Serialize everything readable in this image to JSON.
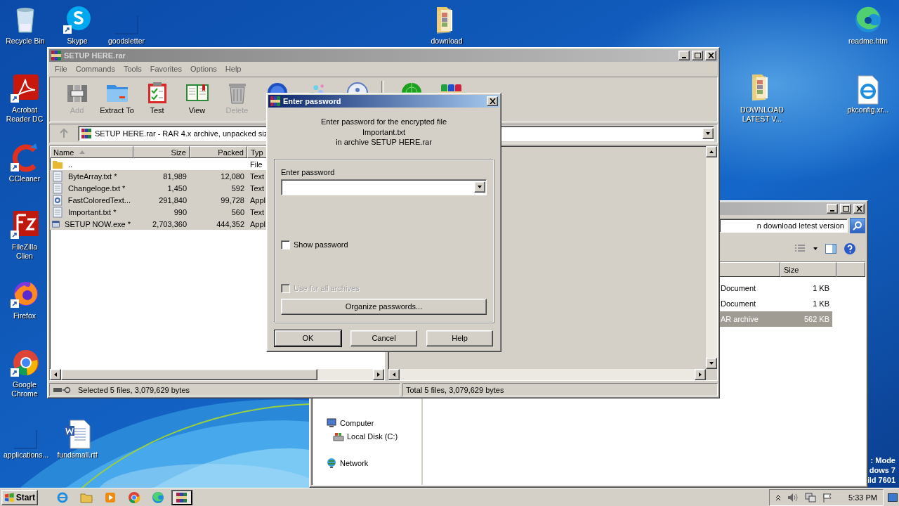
{
  "desktop": {
    "icons": [
      {
        "label": "Recycle Bin",
        "kind": "recycle"
      },
      {
        "label": "Skype",
        "kind": "skype"
      },
      {
        "label": "goodsletter",
        "kind": "blank"
      },
      {
        "label": "download",
        "kind": "rarfolder"
      },
      {
        "label": "readme.htm",
        "kind": "edge"
      },
      {
        "label": "Acrobat Reader DC",
        "kind": "acrobat"
      },
      {
        "label": "DOWNLOAD LATEST V...",
        "kind": "rarfolder"
      },
      {
        "label": "pkconfig.xr...",
        "kind": "iedoc"
      },
      {
        "label": "CCleaner",
        "kind": "ccleaner"
      },
      {
        "label": "FileZilla Clien",
        "kind": "filezilla"
      },
      {
        "label": "Firefox",
        "kind": "firefox"
      },
      {
        "label": "Google Chrome",
        "kind": "chrome"
      },
      {
        "label": "applications...",
        "kind": "blank"
      },
      {
        "label": "fundsmall.rtf",
        "kind": "worddoc"
      }
    ],
    "edition_text": [
      ": Mode",
      "dows 7",
      "ild 7601"
    ]
  },
  "explorer": {
    "search": "n download letest version",
    "size_header": "Size",
    "rows": [
      {
        "type": "Document",
        "size": "1 KB",
        "selected": false
      },
      {
        "type": "Document",
        "size": "1 KB",
        "selected": false
      },
      {
        "type": "AR archive",
        "size": "562 KB",
        "selected": true
      }
    ],
    "nav": [
      {
        "label": "Computer",
        "kind": "computer",
        "children": [
          {
            "label": "Local Disk (C:)",
            "kind": "disk"
          }
        ]
      },
      {
        "label": "Network",
        "kind": "network"
      }
    ]
  },
  "archiver": {
    "title": "SETUP HERE.rar",
    "menu": [
      "File",
      "Commands",
      "Tools",
      "Favorites",
      "Options",
      "Help"
    ],
    "toolbar": [
      {
        "label": "Add",
        "kind": "add",
        "disabled": true
      },
      {
        "label": "Extract To",
        "kind": "extract",
        "disabled": false
      },
      {
        "label": "Test",
        "kind": "test",
        "disabled": false
      },
      {
        "label": "View",
        "kind": "view",
        "disabled": false
      },
      {
        "label": "Delete",
        "kind": "delete",
        "disabled": true
      },
      {
        "kind": "find"
      },
      {
        "kind": "wizard"
      },
      {
        "kind": "info"
      },
      {
        "kind": "virus"
      },
      {
        "kind": "sfx"
      }
    ],
    "path": "SETUP HERE.rar - RAR 4.x archive, unpacked siz",
    "columns": [
      "Name",
      "Size",
      "Packed",
      "Typ"
    ],
    "files": [
      {
        "name": "..",
        "kind": "folder",
        "type": "File",
        "selected": false
      },
      {
        "name": "ByteArray.txt *",
        "kind": "text",
        "size": "81,989",
        "packed": "12,080",
        "type": "Text",
        "selected": true
      },
      {
        "name": "Changeloge.txt *",
        "kind": "text",
        "size": "1,450",
        "packed": "592",
        "type": "Text",
        "selected": true
      },
      {
        "name": "FastColoredText...",
        "kind": "dll",
        "size": "291,840",
        "packed": "99,728",
        "type": "Appl",
        "selected": true
      },
      {
        "name": "Important.txt *",
        "kind": "text",
        "size": "990",
        "packed": "560",
        "type": "Text",
        "selected": true
      },
      {
        "name": "SETUP NOW.exe *",
        "kind": "exe",
        "size": "2,703,360",
        "packed": "444,352",
        "type": "Appl",
        "selected": true
      }
    ],
    "status_left": "Selected 5 files, 3,079,629 bytes",
    "status_right": "Total 5 files, 3,079,629 bytes"
  },
  "dialog": {
    "title": "Enter password",
    "message": [
      "Enter password for the encrypted file",
      "Important.txt",
      "in archive SETUP HERE.rar"
    ],
    "field_label": "Enter password",
    "checkboxes": [
      {
        "label": "Show password",
        "checked": false,
        "disabled": false
      },
      {
        "label": "Use for all archives",
        "checked": false,
        "disabled": true
      }
    ],
    "organize_button": "Organize passwords...",
    "buttons": [
      {
        "label": "OK",
        "default": true
      },
      {
        "label": "Cancel",
        "default": false
      },
      {
        "label": "Help",
        "default": false
      }
    ]
  },
  "taskbar": {
    "start": "Start",
    "apps": [
      {
        "kind": "ie",
        "active": false
      },
      {
        "kind": "explorer",
        "active": false
      },
      {
        "kind": "media",
        "active": false
      },
      {
        "kind": "chrome",
        "active": false
      },
      {
        "kind": "edge",
        "active": false
      },
      {
        "kind": "winrar",
        "active": true
      }
    ],
    "clock": "5:33 PM"
  }
}
